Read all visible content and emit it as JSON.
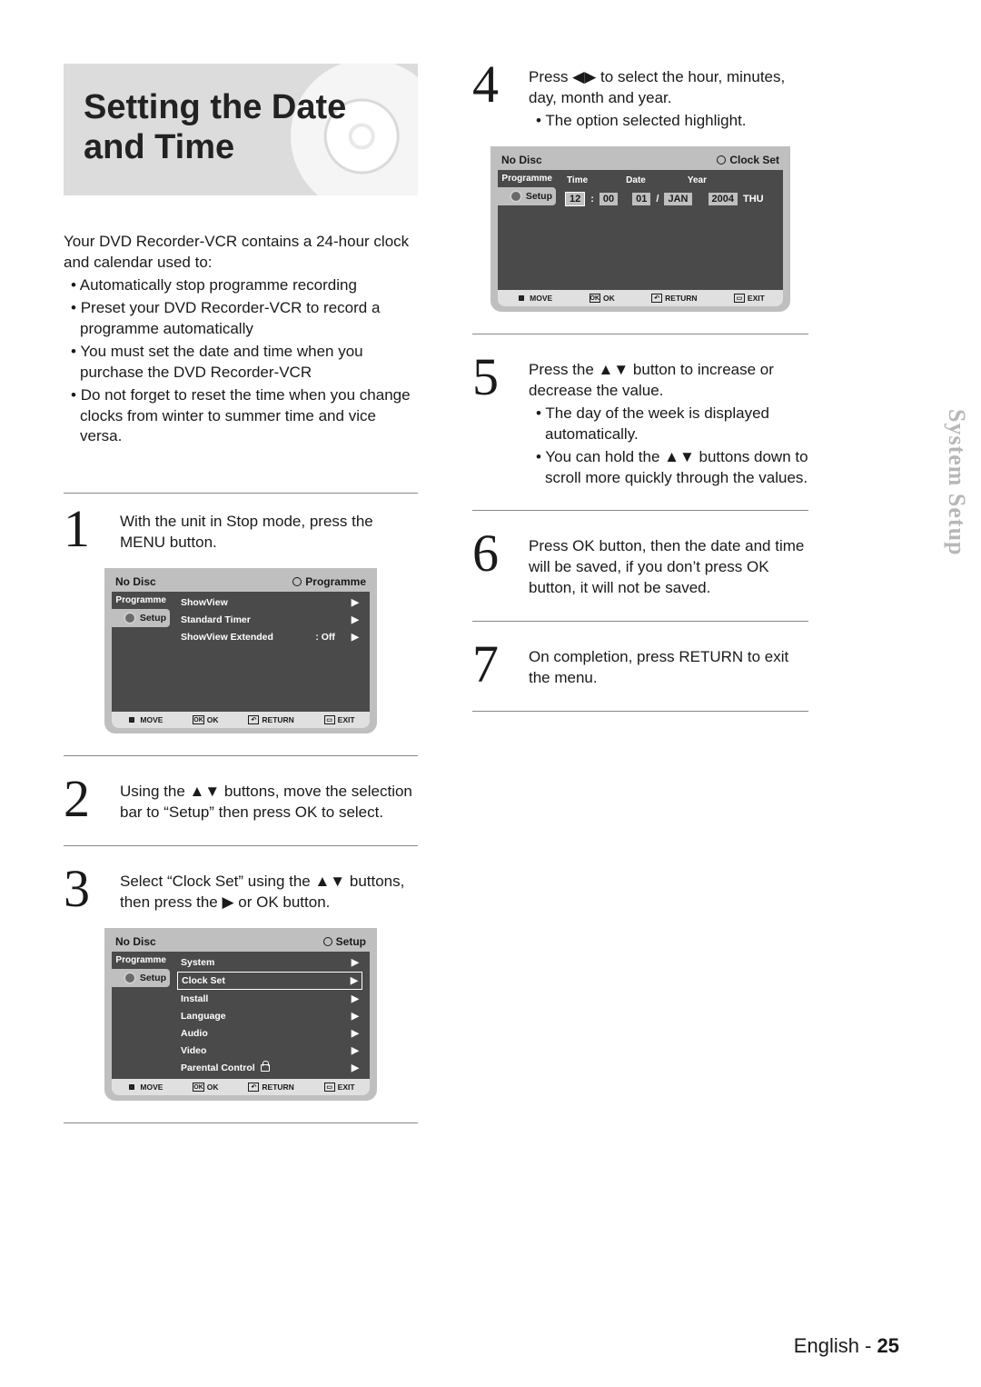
{
  "title": "Setting the Date and Time",
  "intro": {
    "lead": "Your DVD Recorder-VCR contains a 24-hour clock and calendar used to:",
    "bullets": [
      "Automatically stop programme recording",
      "Preset your DVD Recorder-VCR to record a programme automatically",
      "You must set the date and time when you purchase the DVD Recorder-VCR",
      "Do not forget to reset the time when you change clocks from winter to summer time and vice versa."
    ]
  },
  "steps": {
    "1": "With the unit in Stop mode, press the MENU button.",
    "2_a": "Using the ",
    "2_b": " buttons, move the selection bar to “Setup” then press OK to select.",
    "3_a": "Select “Clock Set” using the ",
    "3_b": " buttons, then press the ▶ or OK button.",
    "4_a": "Press ◀▶ to select the hour, minutes, day, month and year.",
    "4_b": "The option selected highlight.",
    "5_a": "Press the ",
    "5_b": " button to increase or decrease the value.",
    "5_c": "The day of the week is displayed automatically.",
    "5_d": "You can hold the ",
    "5_e": " buttons down to scroll more quickly through the values.",
    "6": "Press OK button, then the date and time will be saved, if you don’t press OK button, it will not be saved.",
    "7": "On completion, press RETURN to exit the menu."
  },
  "screen1": {
    "status": "No Disc",
    "title": "Programme",
    "sidebar": {
      "top": "Programme",
      "selected": "Setup"
    },
    "items": [
      {
        "label": "ShowView"
      },
      {
        "label": "Standard Timer"
      },
      {
        "label": "ShowView Extended",
        "value": ": Off"
      }
    ]
  },
  "screen3": {
    "status": "No Disc",
    "title": "Setup",
    "sidebar": {
      "top": "Programme",
      "selected": "Setup"
    },
    "items": [
      {
        "label": "System"
      },
      {
        "label": "Clock Set",
        "selected": true
      },
      {
        "label": "Install"
      },
      {
        "label": "Language"
      },
      {
        "label": "Audio"
      },
      {
        "label": "Video"
      },
      {
        "label": "Parental Control",
        "lock": true
      }
    ]
  },
  "screen4": {
    "status": "No Disc",
    "title": "Clock Set",
    "sidebar": {
      "top": "Programme",
      "selected": "Setup"
    },
    "head_time": "Time",
    "head_date": "Date",
    "head_year": "Year",
    "h": "12",
    "m": "00",
    "d": "01",
    "mo": "JAN",
    "y": "2004",
    "dow": "THU"
  },
  "footbar": {
    "move": "MOVE",
    "ok": "OK",
    "return": "RETURN",
    "exit": "EXIT"
  },
  "side_tab": "System Setup",
  "pagefoot": {
    "lang": "English - ",
    "num": "25"
  },
  "glyphs": {
    "updown": "▲▼",
    "right": "▶"
  }
}
